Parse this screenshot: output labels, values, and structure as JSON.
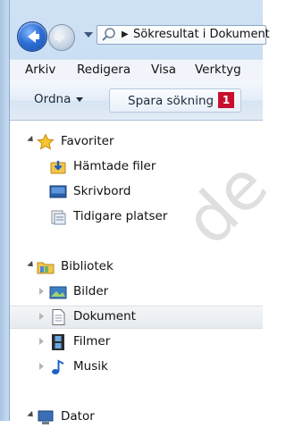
{
  "address_bar": {
    "path": "Sökresultat i Dokument"
  },
  "menu": [
    "Arkiv",
    "Redigera",
    "Visa",
    "Verktyg"
  ],
  "command_bar": {
    "organize_label": "Ordna",
    "save_search_label": "Spara sökning",
    "badge": "1"
  },
  "nav_tree": {
    "favorites": {
      "label": "Favoriter",
      "items": [
        "Hämtade filer",
        "Skrivbord",
        "Tidigare platser"
      ]
    },
    "libraries": {
      "label": "Bibliotek",
      "items": [
        "Bilder",
        "Dokument",
        "Filmer",
        "Musik"
      ],
      "selected": "Dokument"
    },
    "computer": {
      "label": "Dator"
    }
  },
  "watermark": "de",
  "colors": {
    "accent_red": "#c8102e",
    "frame_blue": "#bcd5ee"
  }
}
